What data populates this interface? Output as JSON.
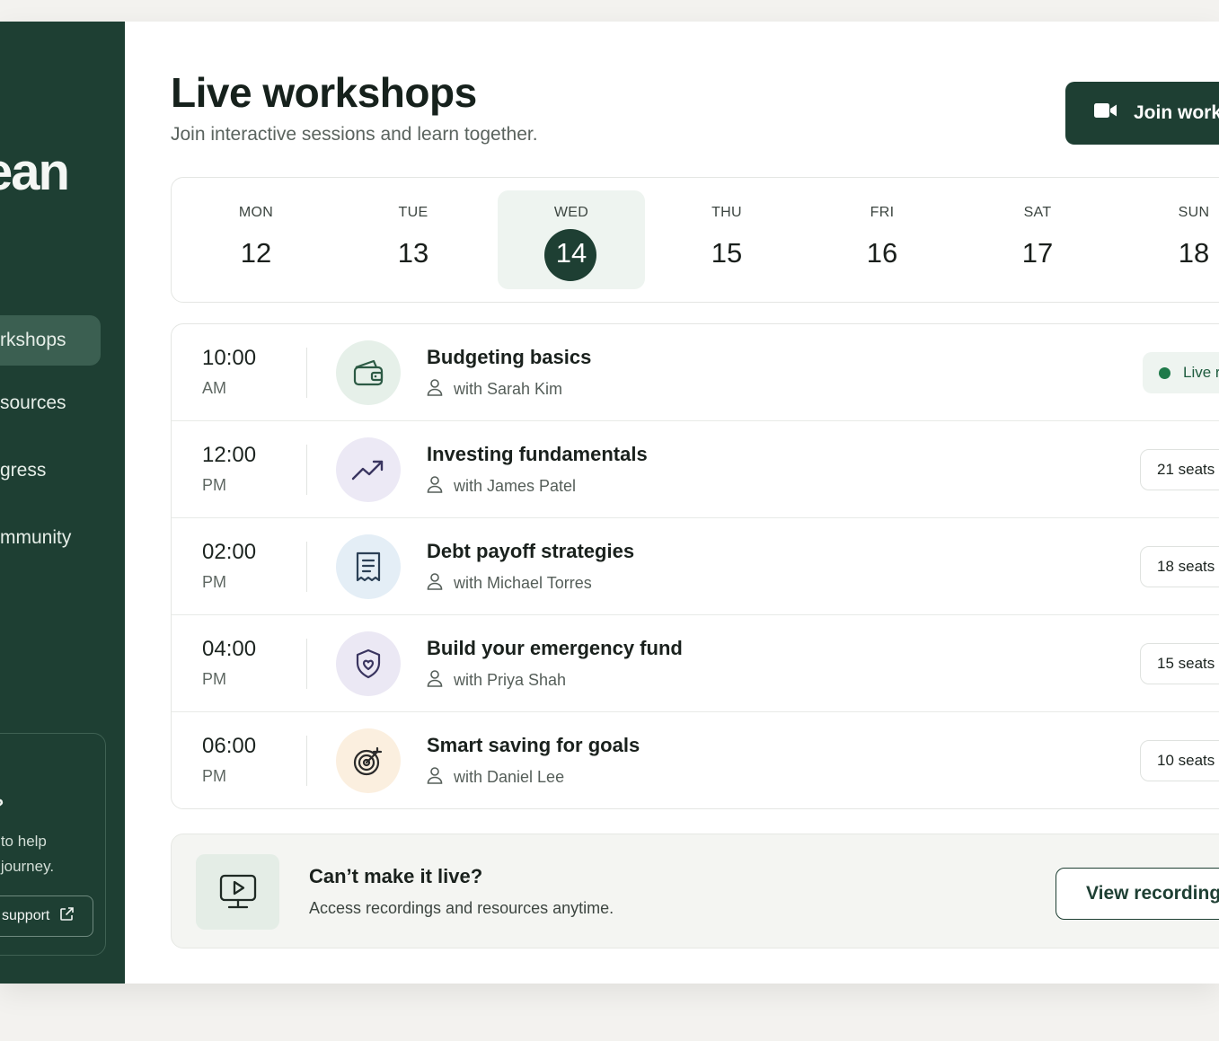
{
  "sidebar": {
    "brand": "ean",
    "nav": [
      {
        "label": "rkshops",
        "active": true
      },
      {
        "label": "sources",
        "active": false
      },
      {
        "label": "gress",
        "active": false
      },
      {
        "label": "mmunity",
        "active": false
      }
    ],
    "help": {
      "title": "p?",
      "line1": "re to help",
      "line2": "ur journey.",
      "button_label": "support",
      "button_icon": "external-link-icon"
    }
  },
  "header": {
    "title": "Live workshops",
    "subtitle": "Join interactive sessions and learn together.",
    "join_button": {
      "label": "Join work",
      "icon": "video-camera-icon"
    }
  },
  "calendar": {
    "days": [
      {
        "name": "MON",
        "num": "12"
      },
      {
        "name": "TUE",
        "num": "13"
      },
      {
        "name": "WED",
        "num": "14",
        "selected": true
      },
      {
        "name": "THU",
        "num": "15"
      },
      {
        "name": "FRI",
        "num": "16"
      },
      {
        "name": "SAT",
        "num": "17"
      },
      {
        "name": "SUN",
        "num": "18"
      }
    ]
  },
  "workshops": [
    {
      "time": "10:00",
      "ampm": "AM",
      "title": "Budgeting basics",
      "host": "with Sarah Kim",
      "icon": "wallet-icon",
      "icon_bg": "#e6f0e9",
      "icon_color": "#2c5a44",
      "status": "Live r",
      "is_live": true
    },
    {
      "time": "12:00",
      "ampm": "PM",
      "title": "Investing fundamentals",
      "host": "with James Patel",
      "icon": "trend-up-icon",
      "icon_bg": "#ece9f5",
      "icon_color": "#3a3560",
      "status": "21 seats",
      "is_live": false
    },
    {
      "time": "02:00",
      "ampm": "PM",
      "title": "Debt payoff strategies",
      "host": "with Michael Torres",
      "icon": "receipt-icon",
      "icon_bg": "#e4eef6",
      "icon_color": "#2b4056",
      "status": "18 seats",
      "is_live": false
    },
    {
      "time": "04:00",
      "ampm": "PM",
      "title": "Build your emergency fund",
      "host": "with Priya Shah",
      "icon": "shield-icon",
      "icon_bg": "#ebe8f4",
      "icon_color": "#3a3560",
      "status": "15 seats",
      "is_live": false
    },
    {
      "time": "06:00",
      "ampm": "PM",
      "title": "Smart saving for goals",
      "host": "with Daniel Lee",
      "icon": "target-icon",
      "icon_bg": "#fbefdf",
      "icon_color": "#2a2a2a",
      "status": "10 seats",
      "is_live": false
    }
  ],
  "recordings": {
    "title": "Can’t make it live?",
    "subtitle": "Access recordings and resources anytime.",
    "button_label": "View recording",
    "icon": "monitor-play-icon"
  },
  "colors": {
    "brand_dark": "#1e3f33",
    "live_green": "#1f7a4a"
  }
}
